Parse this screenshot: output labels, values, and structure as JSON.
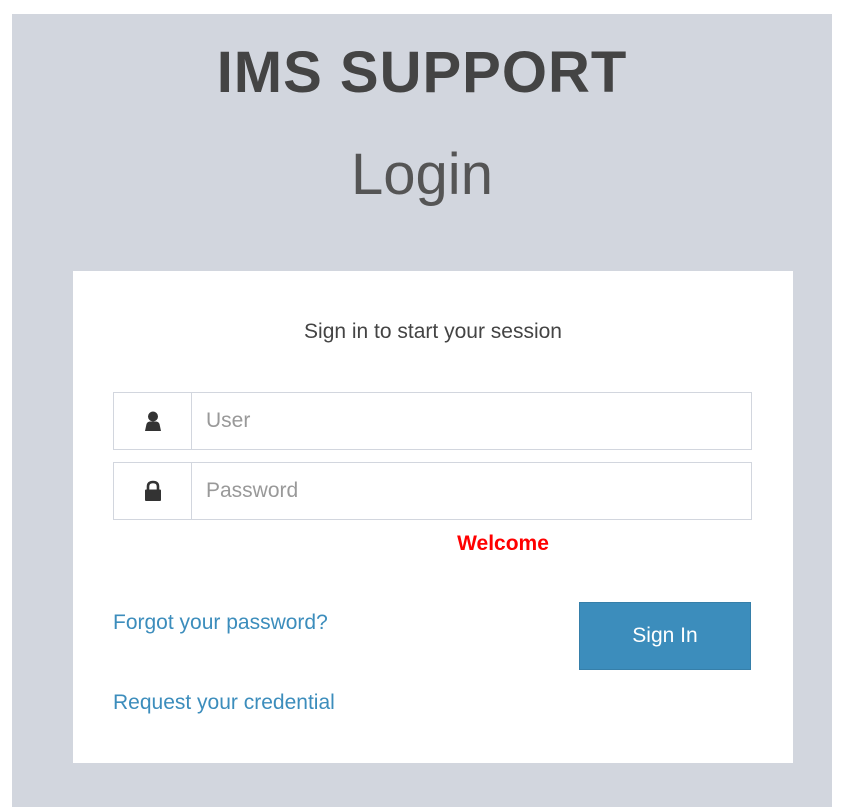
{
  "header": {
    "app_title": "IMS SUPPORT",
    "page_title": "Login"
  },
  "login_box": {
    "message": "Sign in to start your session",
    "user_field": {
      "placeholder": "User",
      "value": "",
      "icon": "user-icon"
    },
    "password_field": {
      "placeholder": "Password",
      "value": "",
      "icon": "lock-icon"
    },
    "status_message": "Welcome",
    "forgot_link": "Forgot your password?",
    "request_link": "Request your credential",
    "sign_in_label": "Sign In"
  },
  "colors": {
    "page_background": "#d2d6de",
    "accent": "#3c8dbc",
    "status": "#ff0000"
  }
}
